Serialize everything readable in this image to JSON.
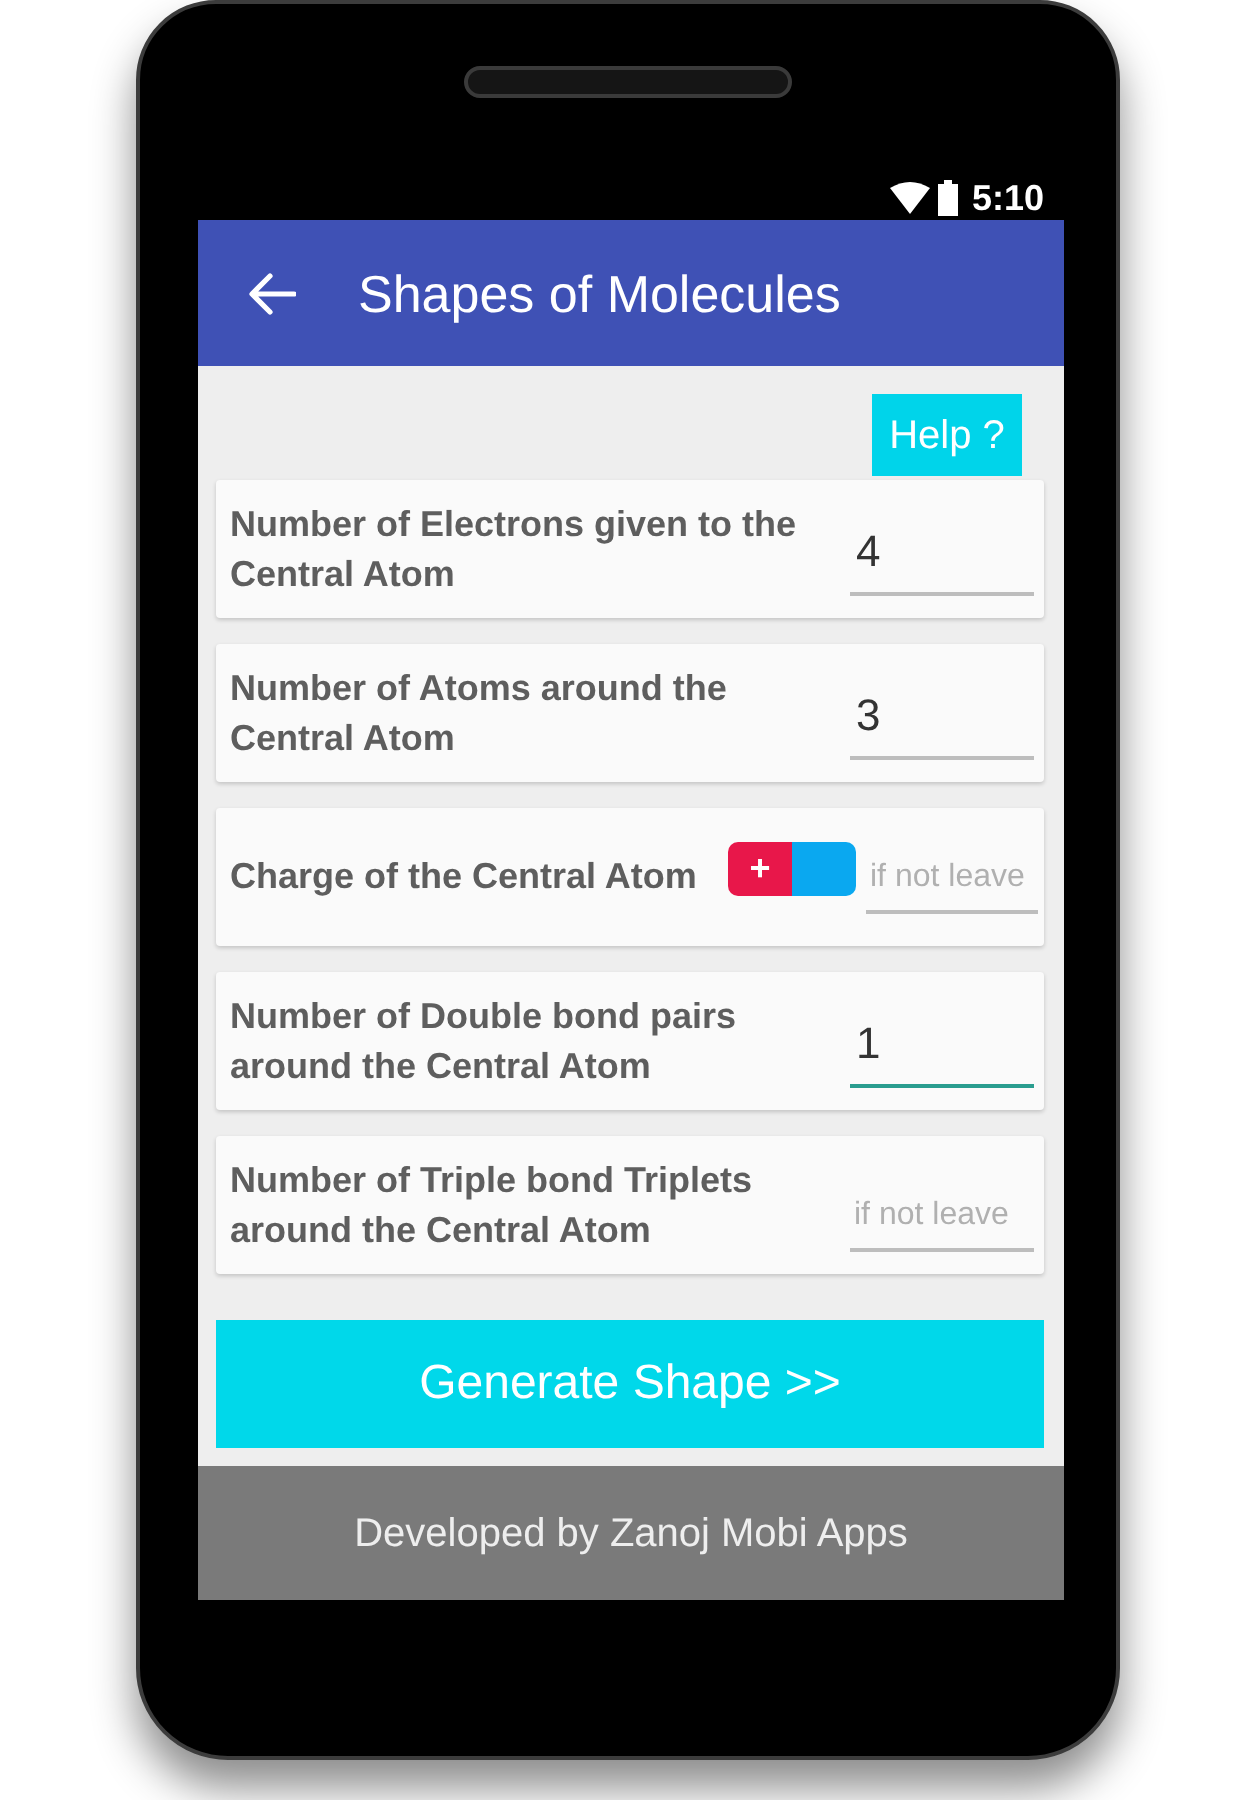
{
  "status_bar": {
    "time": "5:10"
  },
  "app_bar": {
    "title": "Shapes of Molecules"
  },
  "help_button": {
    "label": "Help ?"
  },
  "rows": [
    {
      "kind": "number",
      "label": "Number of Electrons given to the Central Atom",
      "field": {
        "value": "4",
        "focused": false
      }
    },
    {
      "kind": "number",
      "label": "Number of Atoms around the Central Atom",
      "field": {
        "value": "3",
        "focused": false
      }
    },
    {
      "kind": "charge",
      "label": "Charge of the Central Atom",
      "toggle": {
        "label": "+",
        "on": true
      },
      "field": {
        "placeholder": "if not leave",
        "focused": false
      }
    },
    {
      "kind": "number",
      "label": "Number of Double bond pairs around the Central Atom",
      "field": {
        "value": "1",
        "focused": true
      }
    },
    {
      "kind": "number",
      "label": "Number of Triple bond Triplets around the Central Atom",
      "field": {
        "placeholder": "if not leave",
        "focused": false
      }
    }
  ],
  "generate_button": {
    "label": "Generate Shape >>"
  },
  "footer": {
    "text": "Developed by Zanoj Mobi Apps"
  }
}
